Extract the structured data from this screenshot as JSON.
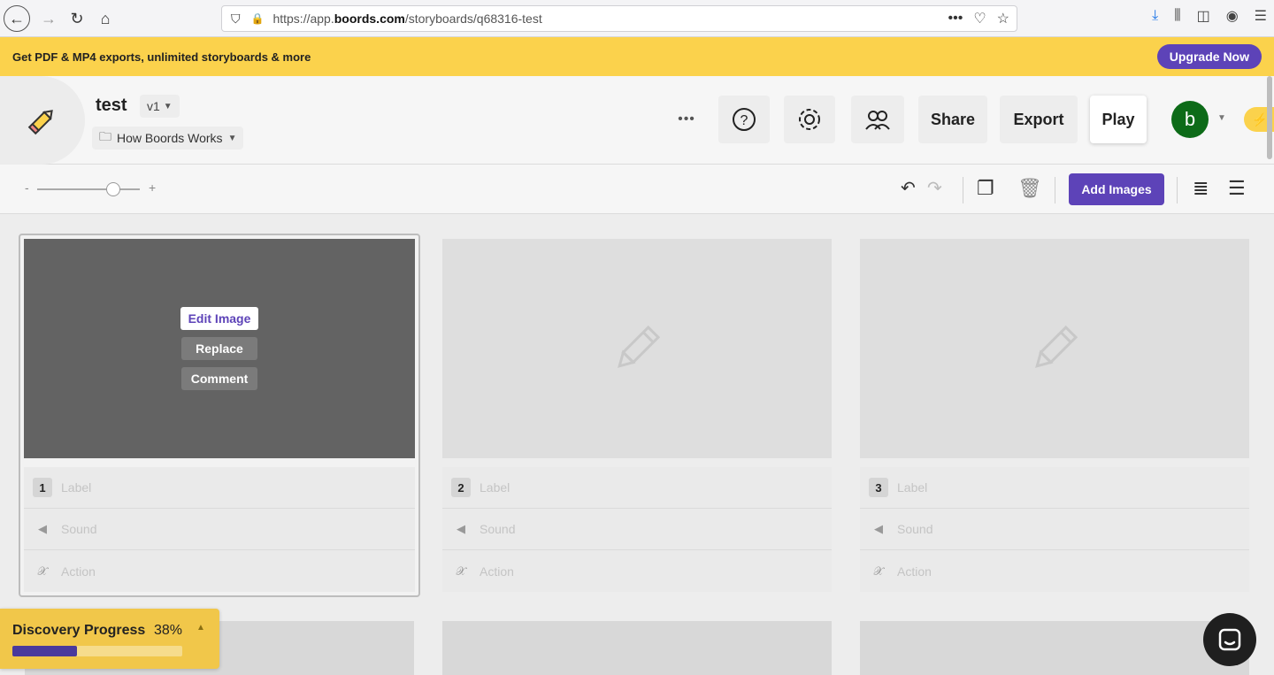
{
  "browser": {
    "url_prefix": "https://app.",
    "url_domain": "boords.com",
    "url_path": "/storyboards/q68316-test"
  },
  "promo": {
    "text": "Get PDF & MP4 exports, unlimited storyboards & more",
    "upgrade_label": "Upgrade Now"
  },
  "header": {
    "project_title": "test",
    "version": "v1",
    "folder": "How Boords Works",
    "more_label": "•••",
    "share_label": "Share",
    "export_label": "Export",
    "play_label": "Play",
    "avatar_initial": "b"
  },
  "toolbar": {
    "zoom_minus": "-",
    "zoom_plus": "+",
    "add_images_label": "Add Images"
  },
  "frames": [
    {
      "number": "1",
      "label_placeholder": "Label",
      "sound_placeholder": "Sound",
      "action_placeholder": "Action",
      "menu": {
        "edit": "Edit Image",
        "replace": "Replace",
        "comment": "Comment"
      }
    },
    {
      "number": "2",
      "label_placeholder": "Label",
      "sound_placeholder": "Sound",
      "action_placeholder": "Action"
    },
    {
      "number": "3",
      "label_placeholder": "Label",
      "sound_placeholder": "Sound",
      "action_placeholder": "Action"
    }
  ],
  "discovery": {
    "label": "Discovery Progress",
    "percent_text": "38%",
    "progress": 0.38
  },
  "colors": {
    "accent": "#5d43b8",
    "banner": "#fbd24c",
    "avatar": "#0d6b18"
  }
}
